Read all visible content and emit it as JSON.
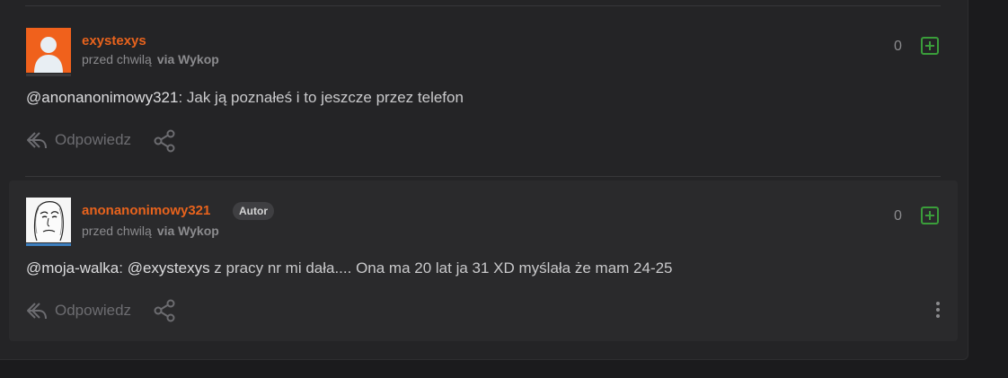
{
  "comments": [
    {
      "username": "exystexys",
      "time": "przed chwilą",
      "via": "via Wykop",
      "score": "0",
      "mention": "@anonanonimowy321",
      "text": ": Jak ją poznałeś i to jeszcze przez telefon",
      "reply_label": "Odpowiedz",
      "avatar": "default-user-avatar",
      "avatar_color": "#f0611c"
    },
    {
      "username": "anonanonimowy321",
      "badge": "Autor",
      "time": "przed chwilą",
      "via": "via Wykop",
      "score": "0",
      "mention1": "@moja-walka",
      "sep": ": ",
      "mention2": "@exystexys",
      "text": " z pracy nr mi dała.... Ona ma 20 lat ja 31 XD myślała że mam 24-25",
      "reply_label": "Odpowiedz",
      "avatar": "wojak-face-avatar",
      "avatar_underline_color": "#3d7fbf"
    }
  ],
  "colors": {
    "username": "#e8631d",
    "plus": "#3a9d3a",
    "background": "#242426"
  }
}
